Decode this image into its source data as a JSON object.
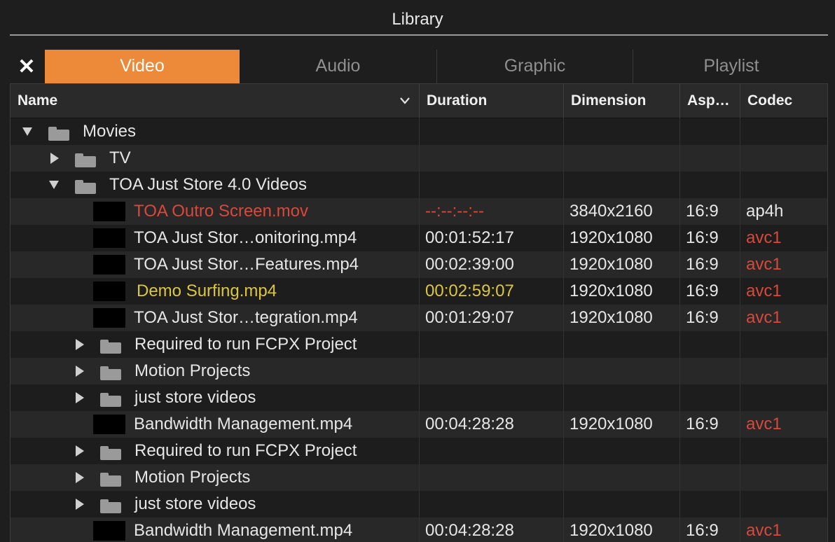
{
  "window": {
    "title": "Library"
  },
  "tabs": [
    {
      "label": "Video",
      "active": true
    },
    {
      "label": "Audio",
      "active": false
    },
    {
      "label": "Graphic",
      "active": false
    },
    {
      "label": "Playlist",
      "active": false
    }
  ],
  "close_label": "✕",
  "columns": {
    "name": "Name",
    "duration": "Duration",
    "dimension": "Dimension",
    "aspect": "Asp…",
    "codec": "Codec"
  },
  "colors": {
    "accent": "#ec8a3a",
    "error": "#d9493b",
    "highlight": "#dcc63c"
  },
  "rows": [
    {
      "type": "folder",
      "level": 0,
      "expanded": true,
      "name": "Movies"
    },
    {
      "type": "folder",
      "level": 1,
      "expanded": false,
      "name": "TV"
    },
    {
      "type": "folder",
      "level": 1,
      "expanded": true,
      "name": "TOA Just Store 4.0 Videos"
    },
    {
      "type": "file",
      "level": 2,
      "name": "TOA Outro Screen.mov",
      "duration": "--:--:--:--",
      "dimension": "3840x2160",
      "aspect": "16:9",
      "codec": "ap4h",
      "name_style": "red",
      "duration_style": "red",
      "codec_style": ""
    },
    {
      "type": "file",
      "level": 2,
      "name": "TOA Just Stor…onitoring.mp4",
      "duration": "00:01:52:17",
      "dimension": "1920x1080",
      "aspect": "16:9",
      "codec": "avc1",
      "name_style": "",
      "duration_style": "",
      "codec_style": "red"
    },
    {
      "type": "file",
      "level": 2,
      "name": "TOA Just Stor…Features.mp4",
      "duration": "00:02:39:00",
      "dimension": "1920x1080",
      "aspect": "16:9",
      "codec": "avc1",
      "name_style": "",
      "duration_style": "",
      "codec_style": "red"
    },
    {
      "type": "file",
      "level": 2,
      "name": "Demo Surfing.mp4",
      "duration": "00:02:59:07",
      "dimension": "1920x1080",
      "aspect": "16:9",
      "codec": "avc1",
      "name_style": "yellow",
      "duration_style": "yellow",
      "codec_style": "red"
    },
    {
      "type": "file",
      "level": 2,
      "name": "TOA Just Stor…tegration.mp4",
      "duration": "00:01:29:07",
      "dimension": "1920x1080",
      "aspect": "16:9",
      "codec": "avc1",
      "name_style": "",
      "duration_style": "",
      "codec_style": "red"
    },
    {
      "type": "folder",
      "level": 2,
      "expanded": false,
      "name": "Required to run FCPX Project"
    },
    {
      "type": "folder",
      "level": 2,
      "expanded": false,
      "name": "Motion Projects"
    },
    {
      "type": "folder",
      "level": 2,
      "expanded": false,
      "name": "just store videos"
    },
    {
      "type": "file",
      "level": 2,
      "name": "Bandwidth Management.mp4",
      "duration": "00:04:28:28",
      "dimension": "1920x1080",
      "aspect": "16:9",
      "codec": "avc1",
      "name_style": "",
      "duration_style": "",
      "codec_style": "red"
    },
    {
      "type": "folder",
      "level": 2,
      "expanded": false,
      "name": "Required to run FCPX Project"
    },
    {
      "type": "folder",
      "level": 2,
      "expanded": false,
      "name": "Motion Projects"
    },
    {
      "type": "folder",
      "level": 2,
      "expanded": false,
      "name": "just store videos"
    },
    {
      "type": "file",
      "level": 2,
      "name": "Bandwidth Management.mp4",
      "duration": "00:04:28:28",
      "dimension": "1920x1080",
      "aspect": "16:9",
      "codec": "avc1",
      "name_style": "",
      "duration_style": "",
      "codec_style": "red"
    }
  ]
}
